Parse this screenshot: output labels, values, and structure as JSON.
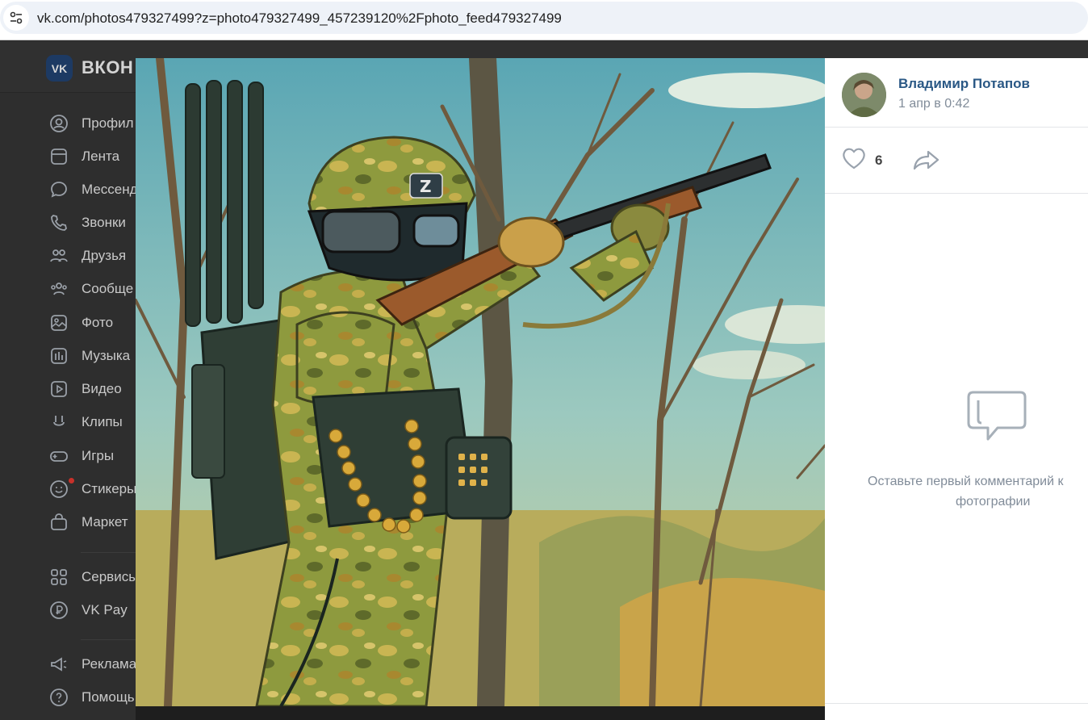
{
  "browser": {
    "url": "vk.com/photos479327499?z=photo479327499_457239120%2Fphoto_feed479327499",
    "site_settings_icon": "tune-icon"
  },
  "vk": {
    "logo_text": "ВКОН",
    "sidebar": {
      "items": [
        {
          "label": "Профил",
          "icon": "profile-icon"
        },
        {
          "label": "Лента",
          "icon": "feed-icon"
        },
        {
          "label": "Мессенд",
          "icon": "messenger-icon"
        },
        {
          "label": "Звонки",
          "icon": "phone-icon"
        },
        {
          "label": "Друзья",
          "icon": "friends-icon"
        },
        {
          "label": "Сообще",
          "icon": "communities-icon"
        },
        {
          "label": "Фото",
          "icon": "photo-icon"
        },
        {
          "label": "Музыка",
          "icon": "music-icon"
        },
        {
          "label": "Видео",
          "icon": "video-icon"
        },
        {
          "label": "Клипы",
          "icon": "clips-icon"
        },
        {
          "label": "Игры",
          "icon": "games-icon"
        },
        {
          "label": "Стикеры",
          "icon": "stickers-icon"
        },
        {
          "label": "Маркет",
          "icon": "market-icon"
        },
        {
          "label": "Сервисы",
          "icon": "services-icon"
        },
        {
          "label": "VK Pay",
          "icon": "vkpay-icon"
        },
        {
          "label": "Реклама",
          "icon": "ads-icon"
        },
        {
          "label": "Помощь",
          "icon": "help-icon"
        }
      ]
    }
  },
  "viewer": {
    "photo_alt": "soldier-illustration",
    "author": {
      "name": "Владимир Потапов",
      "date": "1 апр в 0:42"
    },
    "likes": "6",
    "empty_comments": {
      "line1": "Оставьте первый комментарий к",
      "line2": "фотографии"
    }
  }
}
